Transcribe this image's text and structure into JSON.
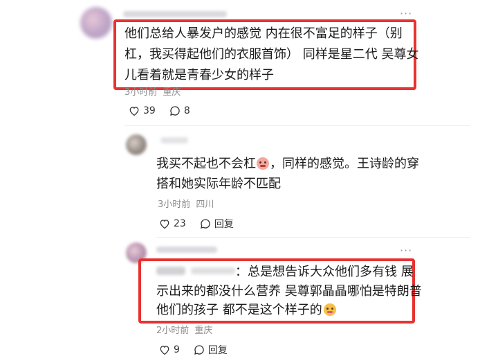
{
  "comments": [
    {
      "text_lines": [
        "他们总给人暴发户的感觉 内在很不富足的样子（别",
        "杠，我买得起他们的衣服首饰） 同样是星二代 吴尊女",
        "儿看着就是青春少女的样子"
      ],
      "time": "3小时前",
      "location": "重庆",
      "likes": "39",
      "replies": "8"
    },
    {
      "text_lines": [
        "我买不起也不会杠",
        "，同样的感觉。王诗龄的穿",
        "搭和她实际年龄不匹配"
      ],
      "time": "3小时前",
      "location": "四川",
      "likes": "23",
      "reply_label": "回复"
    },
    {
      "text_lines": [
        "：总是想告诉大众他们多有钱 展",
        "示出来的都没什么营养 吴尊郭晶晶哪怕是特朗普",
        "他们的孩子 都不是这个样子的"
      ],
      "time": "2小时前",
      "location": "重庆",
      "likes": "9",
      "reply_label": "回复"
    }
  ],
  "icons": {
    "more": "more-dots-icon",
    "like": "heart-icon",
    "reply": "chat-bubble-icon"
  },
  "colors": {
    "highlight": "#e8322f",
    "meta": "#8c8c8c"
  }
}
